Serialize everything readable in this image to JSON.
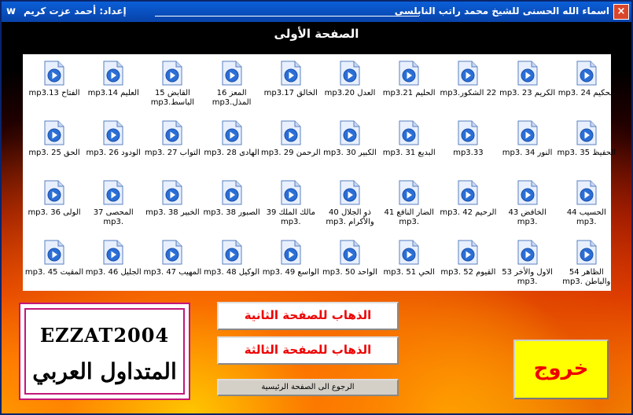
{
  "window": {
    "title": "اسماء الله الحسنى للشيخ محمد راتب النابلسي",
    "author": "إعداد: أحمد عزت كريم",
    "app_icon": "w-logo-icon",
    "close_label": "×"
  },
  "heading": "الصفحة الأولى",
  "files": [
    "الحكيم 24 .mp3",
    "الكريم 23 .mp3",
    "22 الشكور.mp3",
    "الحليم 21.mp3",
    "العدل 20.mp3",
    "الخالق 17.mp3",
    "المعز 16 المذل.mp3",
    "القابض 15 الباسط.mp3",
    "العليم 14.mp3",
    "الفتاح 13.mp3",
    "الحفيظ 35 .mp3",
    "النور 34 .mp3",
    "33.mp3",
    "البديع 31 .mp3",
    "الكبير 30 .mp3",
    "الرحمن 29 .mp3",
    "الهادى 28 .mp3",
    "التواب 27 .mp3",
    "الودود 26 .mp3",
    "الحق 25 .mp3",
    "الحسيب 44 .mp3",
    "الخافض 43 .mp3",
    "الرحيم 42 .mp3",
    "الضار النافع 41 .mp3",
    "ذو الجلال 40 والأكرام .mp3",
    "مالك الملك 39 .mp3",
    "الصبور 38 .mp3",
    "الخبير 38 .mp3",
    "المحصى 37 .mp3",
    "الولى 36 .mp3",
    "الظاهر 54 والباطن .mp3",
    "الاول والأخر 53 .mp3",
    "القيوم 52 .mp3",
    "الحي 51 .mp3",
    "الواحد 50 .mp3",
    "الواسع 49 .mp3",
    "الوكيل 48 .mp3",
    "المهيب 47 .mp3",
    "الجليل 46 .mp3",
    "المقيت 45 .mp3"
  ],
  "logo": {
    "english": "EZZAT2004",
    "arabic": "المتداول العربي"
  },
  "buttons": {
    "page2": "الذهاب للصفحة الثانية",
    "page3": "الذهاب للصفحة الثالثة",
    "home": "الرجوع الى الصفحة الرئيسية",
    "exit": "خروج"
  },
  "colors": {
    "title_bar": "#0842a8",
    "accent_red": "#e00000",
    "exit_bg": "#ffff00"
  }
}
